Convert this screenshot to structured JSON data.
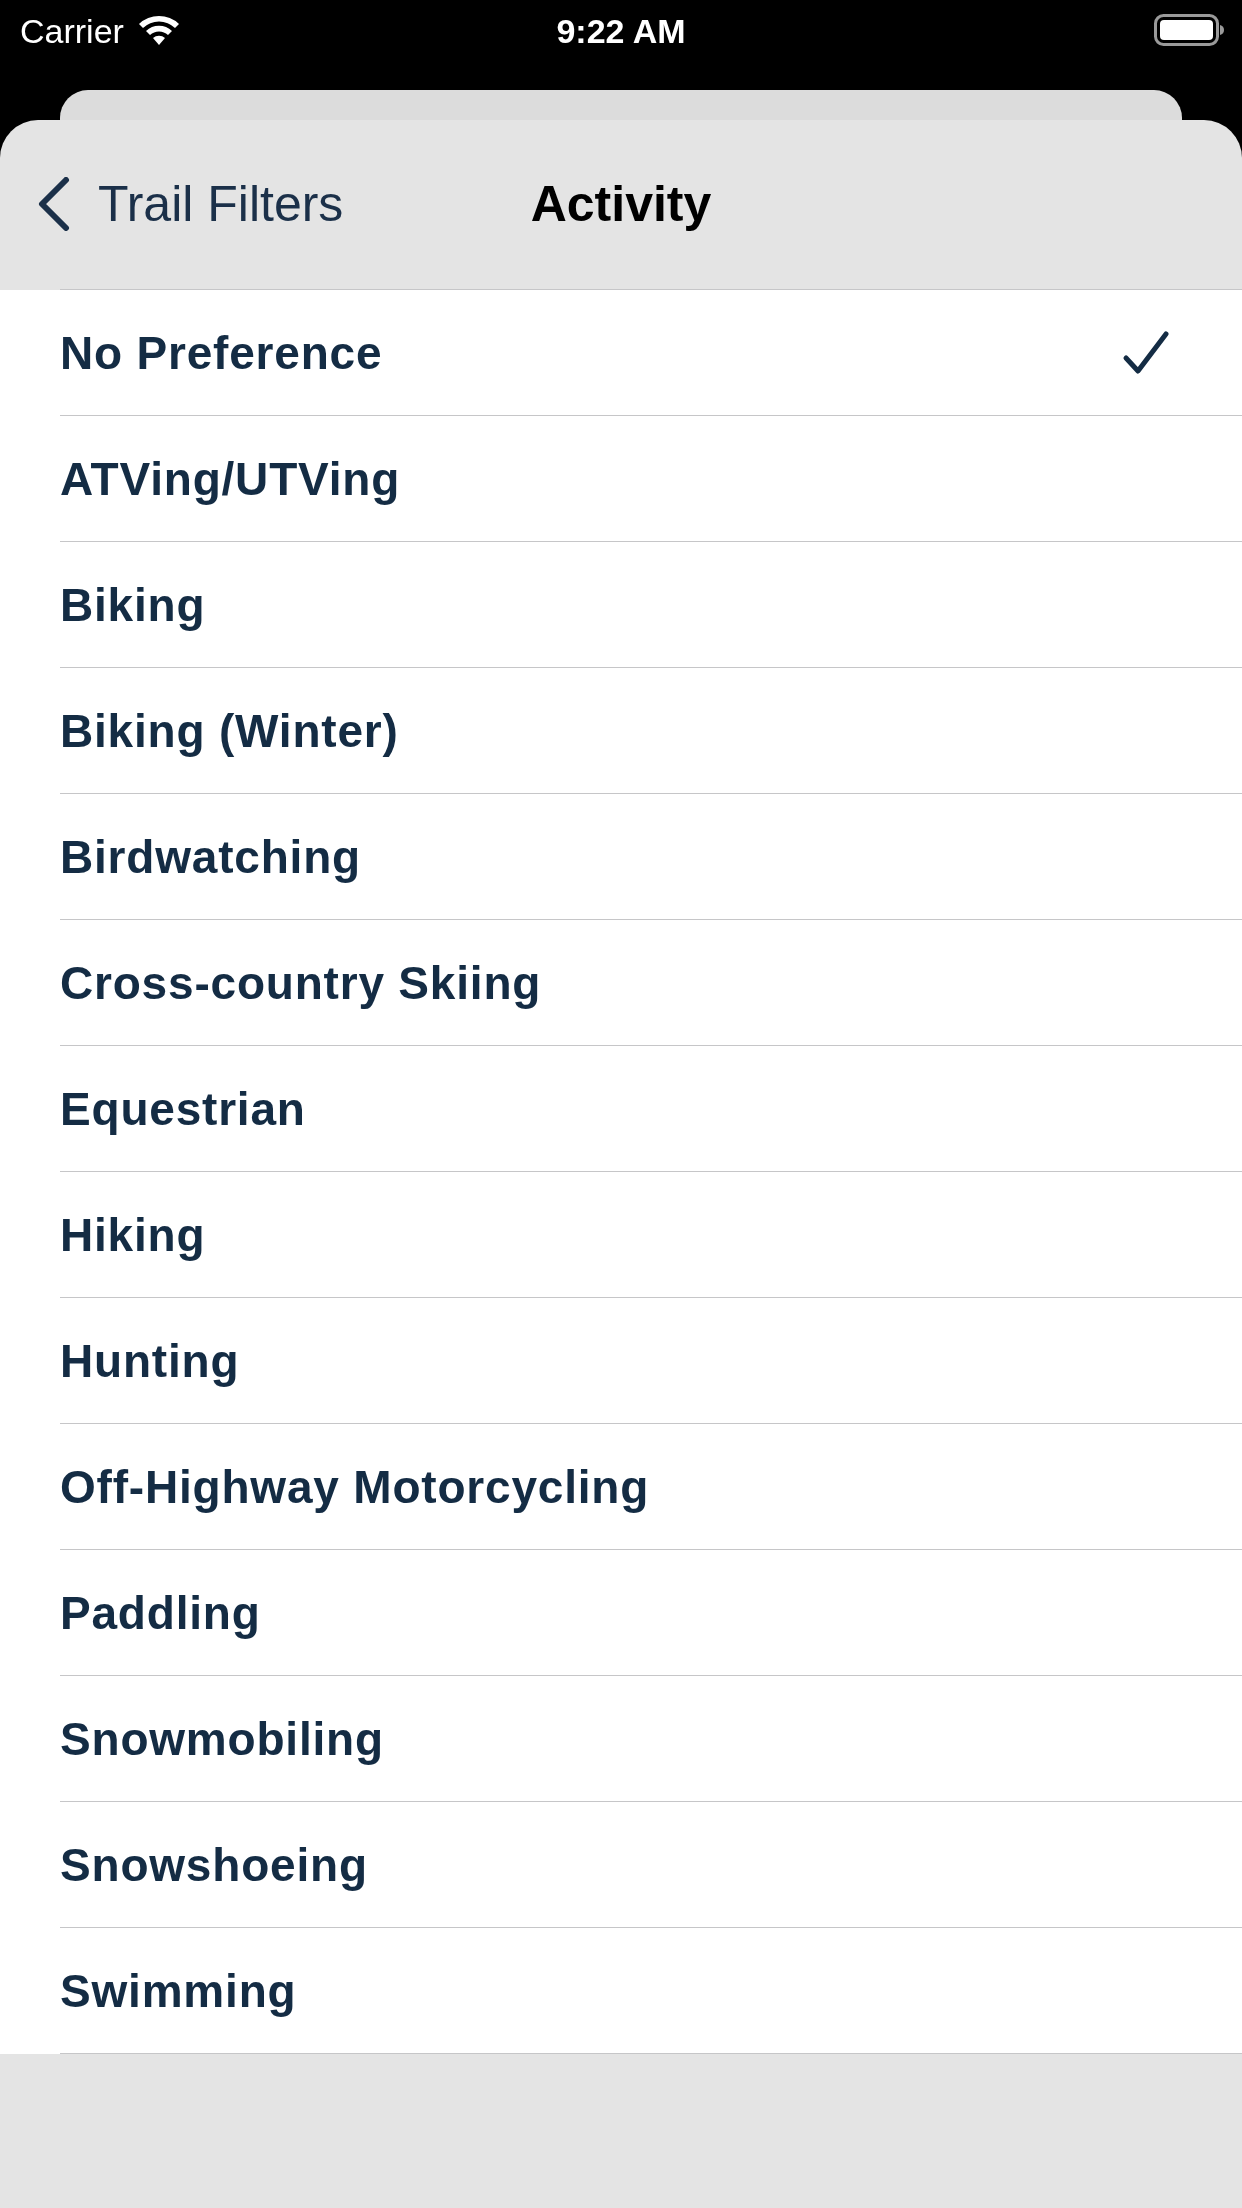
{
  "status_bar": {
    "carrier": "Carrier",
    "time": "9:22 AM"
  },
  "nav": {
    "back_label": "Trail Filters",
    "title": "Activity"
  },
  "options": [
    {
      "label": "No Preference",
      "selected": true
    },
    {
      "label": "ATVing/UTVing",
      "selected": false
    },
    {
      "label": "Biking",
      "selected": false
    },
    {
      "label": "Biking (Winter)",
      "selected": false
    },
    {
      "label": "Birdwatching",
      "selected": false
    },
    {
      "label": "Cross-country Skiing",
      "selected": false
    },
    {
      "label": "Equestrian",
      "selected": false
    },
    {
      "label": "Hiking",
      "selected": false
    },
    {
      "label": "Hunting",
      "selected": false
    },
    {
      "label": "Off-Highway Motorcycling",
      "selected": false
    },
    {
      "label": "Paddling",
      "selected": false
    },
    {
      "label": "Snowmobiling",
      "selected": false
    },
    {
      "label": "Snowshoeing",
      "selected": false
    },
    {
      "label": "Swimming",
      "selected": false
    }
  ]
}
